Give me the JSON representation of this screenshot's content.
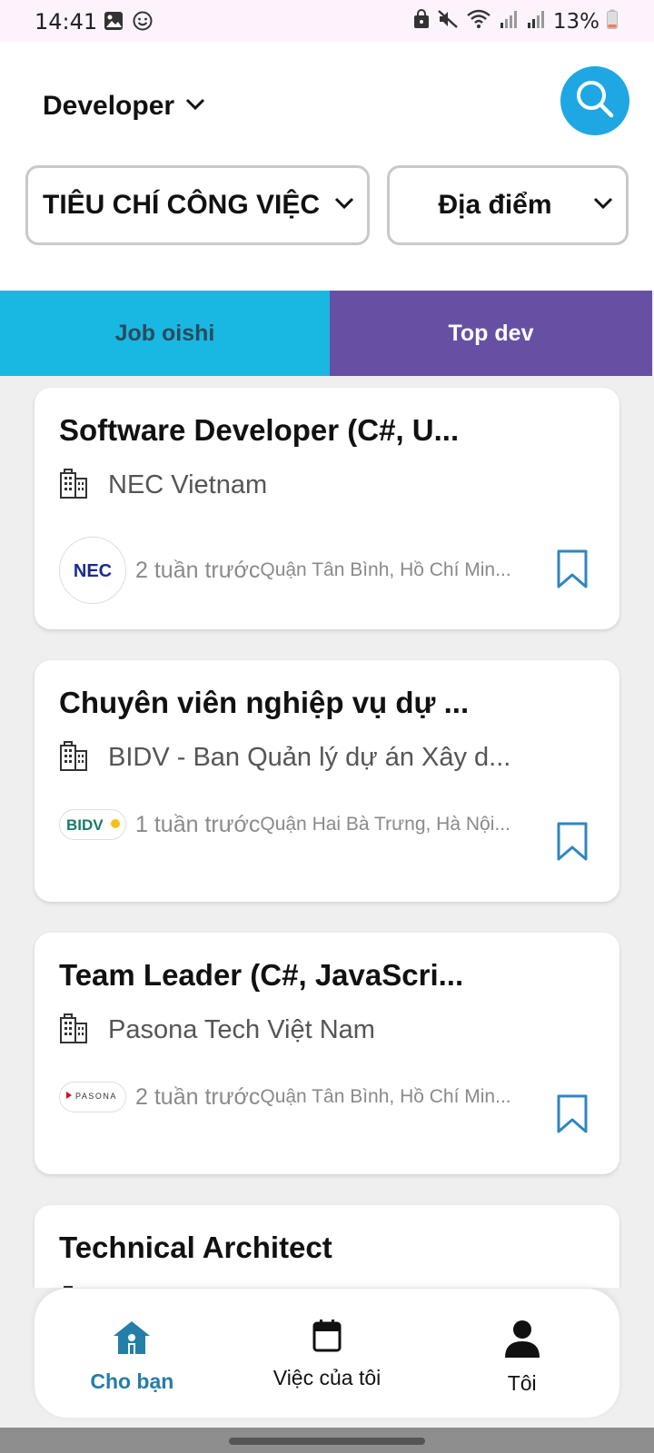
{
  "status_bar": {
    "time": "14:41",
    "battery": "13%",
    "icons": [
      "image-icon",
      "emoji-icon",
      "lock-icon",
      "mute-icon",
      "wifi-icon",
      "signal-icon",
      "signal-icon",
      "battery-icon"
    ]
  },
  "header": {
    "role": "Developer",
    "filters": {
      "criteria": "TIÊU CHÍ CÔNG VIỆC",
      "location": "Địa điểm"
    },
    "search_icon": "search-icon"
  },
  "tabs": [
    {
      "label": "Job oishi",
      "active": false
    },
    {
      "label": "Top dev",
      "active": true
    }
  ],
  "jobs": [
    {
      "title": "Software Developer (C#, U...",
      "company": "NEC Vietnam",
      "logo_text": "NEC",
      "posted": "2 tuần trước",
      "location": "Quận Tân Bình, Hồ Chí Min..."
    },
    {
      "title": "Chuyên viên nghiệp vụ dự ...",
      "company": "BIDV - Ban Quản lý dự án Xây d...",
      "logo_text": "BIDV",
      "posted": "1 tuần trước",
      "location": "Quận Hai Bà Trưng, Hà Nội..."
    },
    {
      "title": "Team Leader (C#, JavaScri...",
      "company": "Pasona Tech Việt Nam",
      "logo_text": "PASONA",
      "posted": "2 tuần trước",
      "location": "Quận Tân Bình, Hồ Chí Min..."
    },
    {
      "title": "Technical Architect",
      "company": "",
      "logo_text": "",
      "posted": "",
      "location": ""
    }
  ],
  "bottom_nav": [
    {
      "label": "Cho bạn",
      "icon": "home-icon",
      "active": true
    },
    {
      "label": "Việc của tôi",
      "icon": "calendar-icon",
      "active": false
    },
    {
      "label": "Tôi",
      "icon": "person-icon",
      "active": false
    }
  ],
  "colors": {
    "accent_blue": "#1ea7e3",
    "tab_cyan": "#18b8e2",
    "tab_purple": "#6650a4",
    "active_nav": "#237ea8",
    "bookmark": "#2f86c0"
  }
}
